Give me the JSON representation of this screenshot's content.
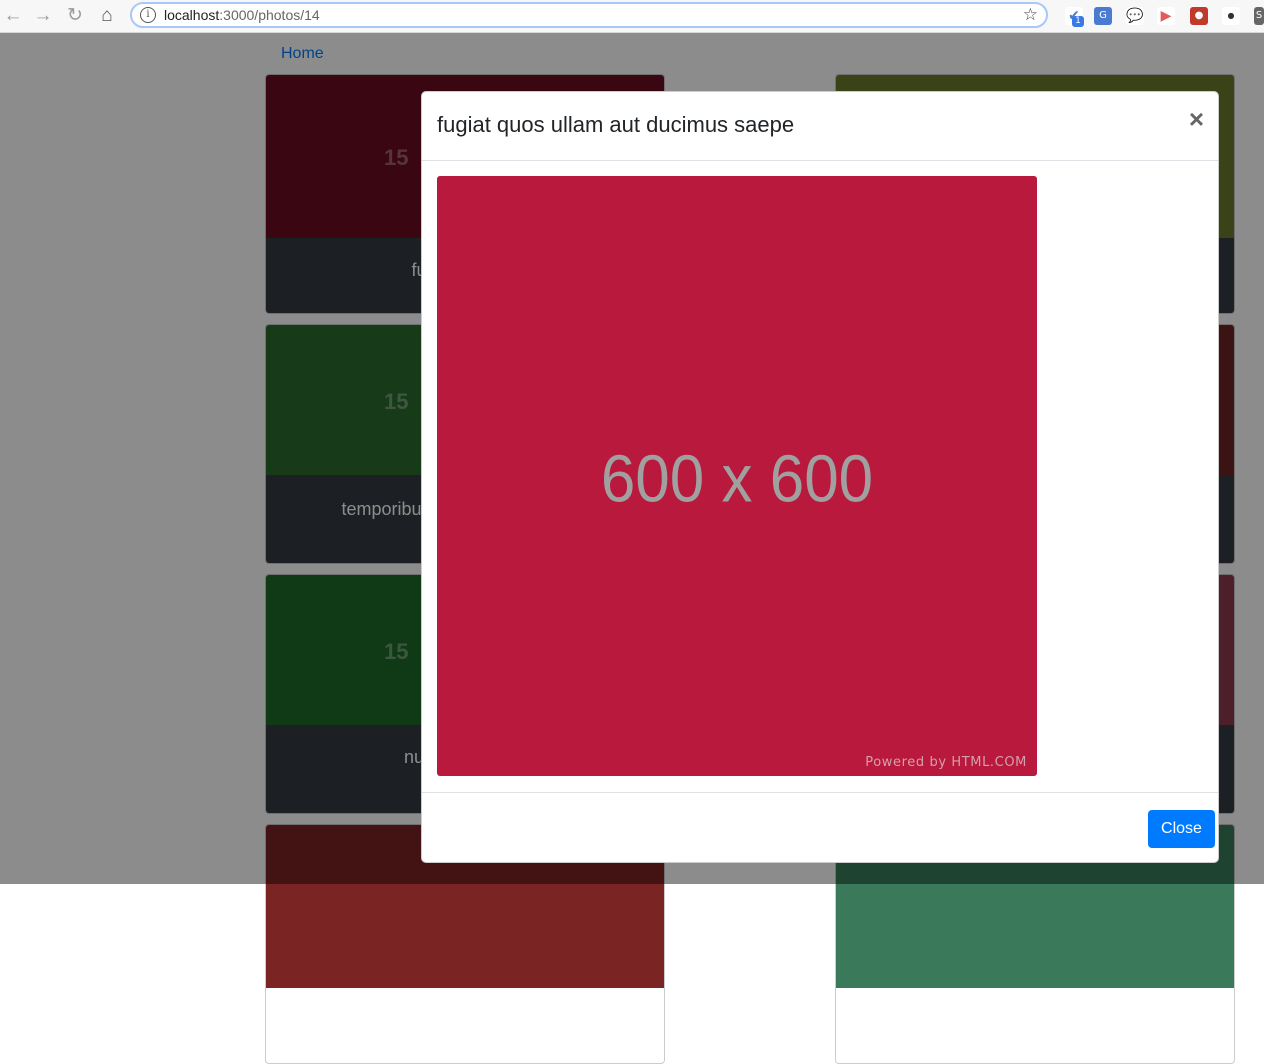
{
  "browser": {
    "url_host": "localhost",
    "url_path": ":3000/photos/14",
    "back_icon": "arrow-left-icon",
    "forward_icon": "arrow-right-icon",
    "reload_icon": "reload-icon",
    "home_icon": "home-icon",
    "extension_badge": "1"
  },
  "page": {
    "home_link": "Home",
    "cards": [
      {
        "color": "#6a0c20",
        "img_text": "15",
        "caption": "fugiat quos ul"
      },
      {
        "color": "#6b7a2c",
        "img_text": "",
        "caption": ""
      },
      {
        "color": "#2a6a2c",
        "img_text": "15",
        "caption": "temporibu dolorem exercitation"
      },
      {
        "color": "#6e2424",
        "img_text": "",
        "caption": ""
      },
      {
        "color": "#1e6a28",
        "img_text": "15",
        "caption": "nulla aut est do"
      },
      {
        "color": "#8a3a4e",
        "img_text": "",
        "caption": ""
      },
      {
        "color": "#7a2424",
        "img_text": "",
        "caption": ""
      },
      {
        "color": "#3a7a5a",
        "img_text": "",
        "caption": ""
      }
    ]
  },
  "modal": {
    "title": "fugiat quos ullam aut ducimus saepe",
    "close_x": "×",
    "image_color": "#b8193c",
    "image_text": "600 x 600",
    "powered_by": "Powered by HTML.COM",
    "close_button": "Close"
  }
}
